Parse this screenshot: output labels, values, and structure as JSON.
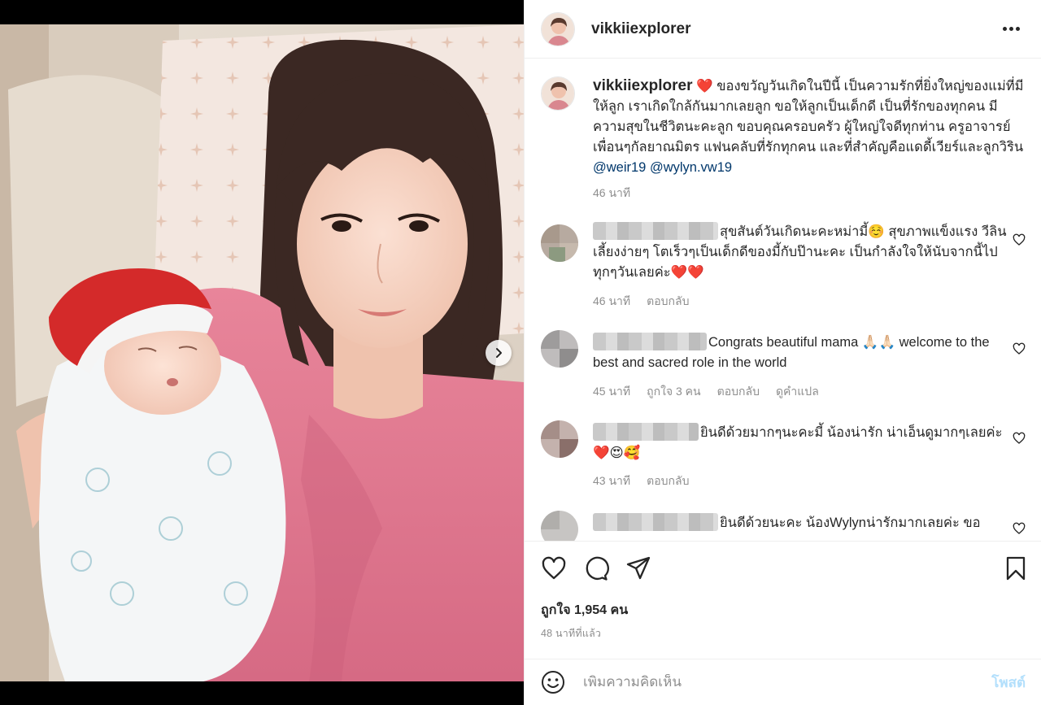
{
  "post": {
    "username": "vikkiiexplorer",
    "caption_heart": "❤️",
    "caption_text": "ของขวัญวันเกิดในปีนี้ เป็นความรักที่ยิ่งใหญ่ของแม่ที่มีให้ลูก เราเกิดใกล้กันมากเลยลูก ขอให้ลูกเป็นเด็กดี เป็นที่รักของทุกคน มีความสุขในชีวิตนะคะลูก ขอบคุณครอบครัว ผู้ใหญ่ใจดีทุกท่าน ครูอาจารย์ เพื่อนๆกัลยาณมิตร แฟนคลับที่รักทุกคน และที่สำคัญคือแดดี้เวียร์และลูกวิริน",
    "mention_1": "@weir19",
    "mention_2": "@wylyn.vw19",
    "caption_time": "46 นาที",
    "more_icon": "more-horizontal-icon"
  },
  "comments": [
    {
      "text": "สุขสันต์วันเกิดนะคะหม่ามี้☺️ สุขภาพแข็งแรง วีลินเลี้ยงง่ายๆ โตเร็วๆเป็นเด็กดีของมี้กับป๊านะคะ เป็นกำลังใจให้นับจากนี้ไปทุกๆวันเลยค่ะ❤️❤️",
      "time": "46 นาที",
      "reply": "ตอบกลับ"
    },
    {
      "text": "Congrats beautiful mama 🙏🏻🙏🏻 welcome to the best and sacred role in the world",
      "time": "45 นาที",
      "likes": "ถูกใจ 3 คน",
      "reply": "ตอบกลับ",
      "translate": "ดูคำแปล"
    },
    {
      "text": "ยินดีด้วยมากๆนะคะมี้ น้องน่ารัก น่าเอ็นดูมากๆเลยค่ะ❤️😍🥰",
      "time": "43 นาที",
      "reply": "ตอบกลับ"
    },
    {
      "text": "ยินดีด้วยนะคะ น้องWylynน่ารักมากเลยค่ะ ขอ"
    }
  ],
  "actions": {
    "like_icon": "heart-icon",
    "comment_icon": "comment-icon",
    "share_icon": "paper-plane-icon",
    "save_icon": "bookmark-icon",
    "likes_count": "ถูกใจ 1,954 คน",
    "post_time": "48 นาทีที่แล้ว"
  },
  "add_comment": {
    "emoji_icon": "smiley-icon",
    "placeholder": "เพิ่มความคิดเห็น",
    "post_label": "โพสต์"
  },
  "media": {
    "next_icon": "chevron-right-icon"
  }
}
